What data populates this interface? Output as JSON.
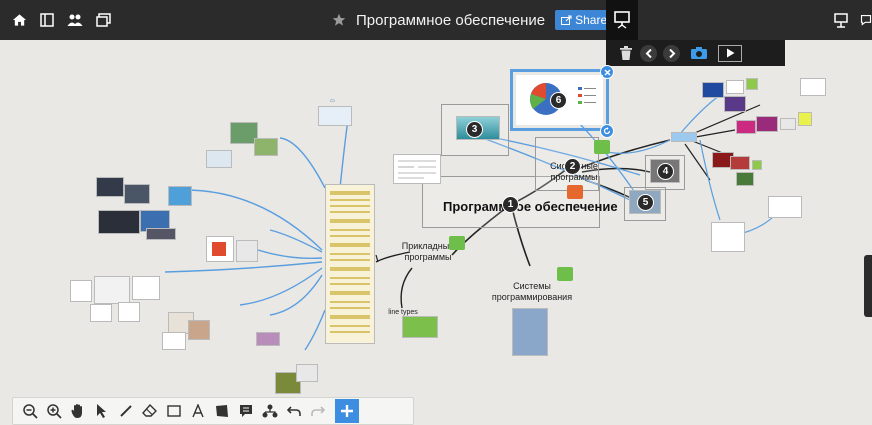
{
  "header": {
    "title": "Программное обеспечение",
    "share_label": "Share"
  },
  "canvas": {
    "main_topic": "Программное обеспечение",
    "branch_applied": "Прикладные программы",
    "branch_system": "Системные программы",
    "branch_programming": "Системы программирования",
    "line_types": "line types",
    "numbers": [
      "1",
      "2",
      "3",
      "4",
      "5",
      "6"
    ]
  },
  "colors": {
    "accent": "#3d86d6",
    "line": "#5a9ee0",
    "comment_green": "#6dbf4a",
    "comment_orange": "#e6682f"
  }
}
